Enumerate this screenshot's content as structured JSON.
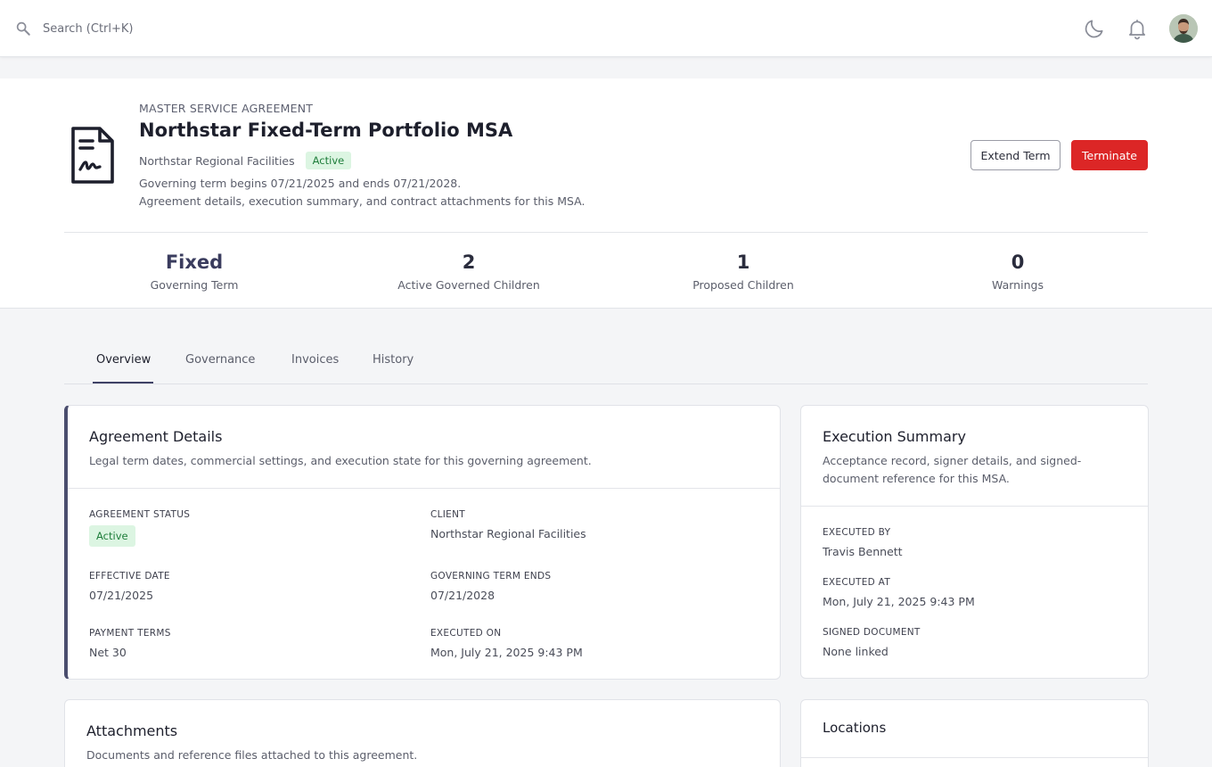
{
  "topbar": {
    "search_placeholder": "Search (Ctrl+K)",
    "icons": [
      "search-icon",
      "moon-icon",
      "bell-icon",
      "avatar"
    ]
  },
  "header": {
    "eyebrow": "MASTER SERVICE AGREEMENT",
    "title": "Northstar Fixed-Term Portfolio MSA",
    "client": "Northstar Regional Facilities",
    "status": "Active",
    "term_text": "Governing term begins 07/21/2025 and ends 07/21/2028.",
    "description": "Agreement details, execution summary, and contract attachments for this MSA.",
    "extend_label": "Extend Term",
    "terminate_label": "Terminate",
    "terminate_color": "#dc2626"
  },
  "stats": [
    {
      "value": "Fixed",
      "label": "Governing Term"
    },
    {
      "value": "2",
      "label": "Active Governed Children"
    },
    {
      "value": "1",
      "label": "Proposed Children"
    },
    {
      "value": "0",
      "label": "Warnings"
    }
  ],
  "tabs": [
    {
      "label": "Overview",
      "active": true
    },
    {
      "label": "Governance",
      "active": false
    },
    {
      "label": "Invoices",
      "active": false
    },
    {
      "label": "History",
      "active": false
    }
  ],
  "details": {
    "title": "Agreement Details",
    "subtitle": "Legal term dates, commercial settings, and execution state for this governing agreement.",
    "status_label": "AGREEMENT STATUS",
    "status_value": "Active",
    "client_label": "CLIENT",
    "client_value": "Northstar Regional Facilities",
    "effective_label": "EFFECTIVE DATE",
    "effective_value": "07/21/2025",
    "term_end_label": "GOVERNING TERM ENDS",
    "term_end_value": "07/21/2028",
    "payment_label": "PAYMENT TERMS",
    "payment_value": "Net 30",
    "executed_on_label": "EXECUTED ON",
    "executed_on_value": "Mon, July 21, 2025 9:43 PM"
  },
  "execution": {
    "title": "Execution Summary",
    "subtitle_line1": "Acceptance record, signer details, and signed-",
    "subtitle_line2": "document reference for this MSA.",
    "by_label": "EXECUTED BY",
    "by_value": "Travis Bennett",
    "at_label": "EXECUTED AT",
    "at_value": "Mon, July 21, 2025 9:43 PM",
    "doc_label": "SIGNED DOCUMENT",
    "doc_value": "None linked"
  },
  "attachments": {
    "title": "Attachments",
    "subtitle": "Documents and reference files attached to this agreement."
  },
  "locations": {
    "title": "Locations"
  },
  "colors": {
    "accent": "#4a4d6e",
    "status_bg": "#dcf5e2",
    "status_text": "#1e7d3a"
  }
}
